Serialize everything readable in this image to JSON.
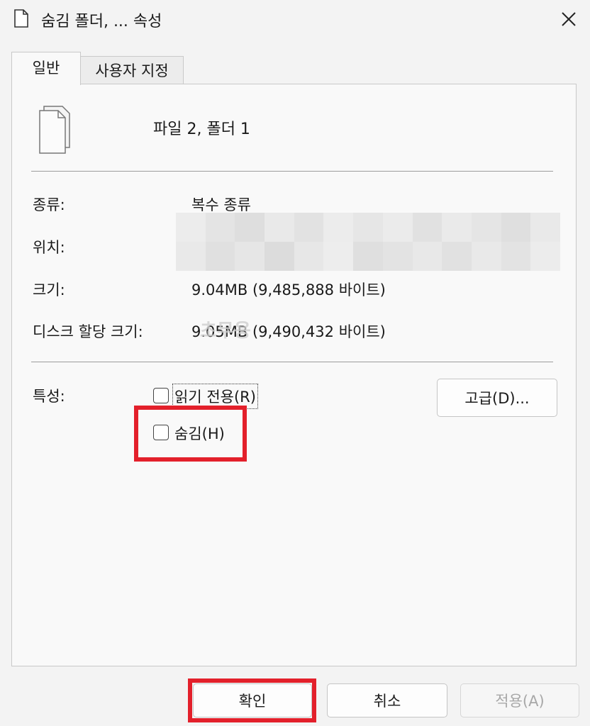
{
  "window": {
    "title": "숨김 폴더, ... 속성"
  },
  "tabs": [
    {
      "label": "일반"
    },
    {
      "label": "사용자 지정"
    }
  ],
  "header": {
    "name": "파일 2, 폴더 1"
  },
  "properties": {
    "type_label": "종류:",
    "type_value": "복수 종류",
    "location_label": "위치:",
    "size_label": "크기:",
    "size_value": "9.04MB (9,485,888 바이트)",
    "disk_label": "디스크 할당 크기:",
    "disk_value": "9.05MB (9,490,432 바이트)"
  },
  "attributes": {
    "label": "특성:",
    "readonly_label": "읽기 전용(R)",
    "readonly_checked": false,
    "hidden_label": "숨김(H)",
    "hidden_checked": false,
    "advanced_label": "고급(D)..."
  },
  "watermark": "초무용",
  "buttons": {
    "ok": "확인",
    "cancel": "취소",
    "apply": "적용(A)"
  },
  "colors": {
    "highlight": "#e3202b",
    "background": "#f3f3f3"
  }
}
